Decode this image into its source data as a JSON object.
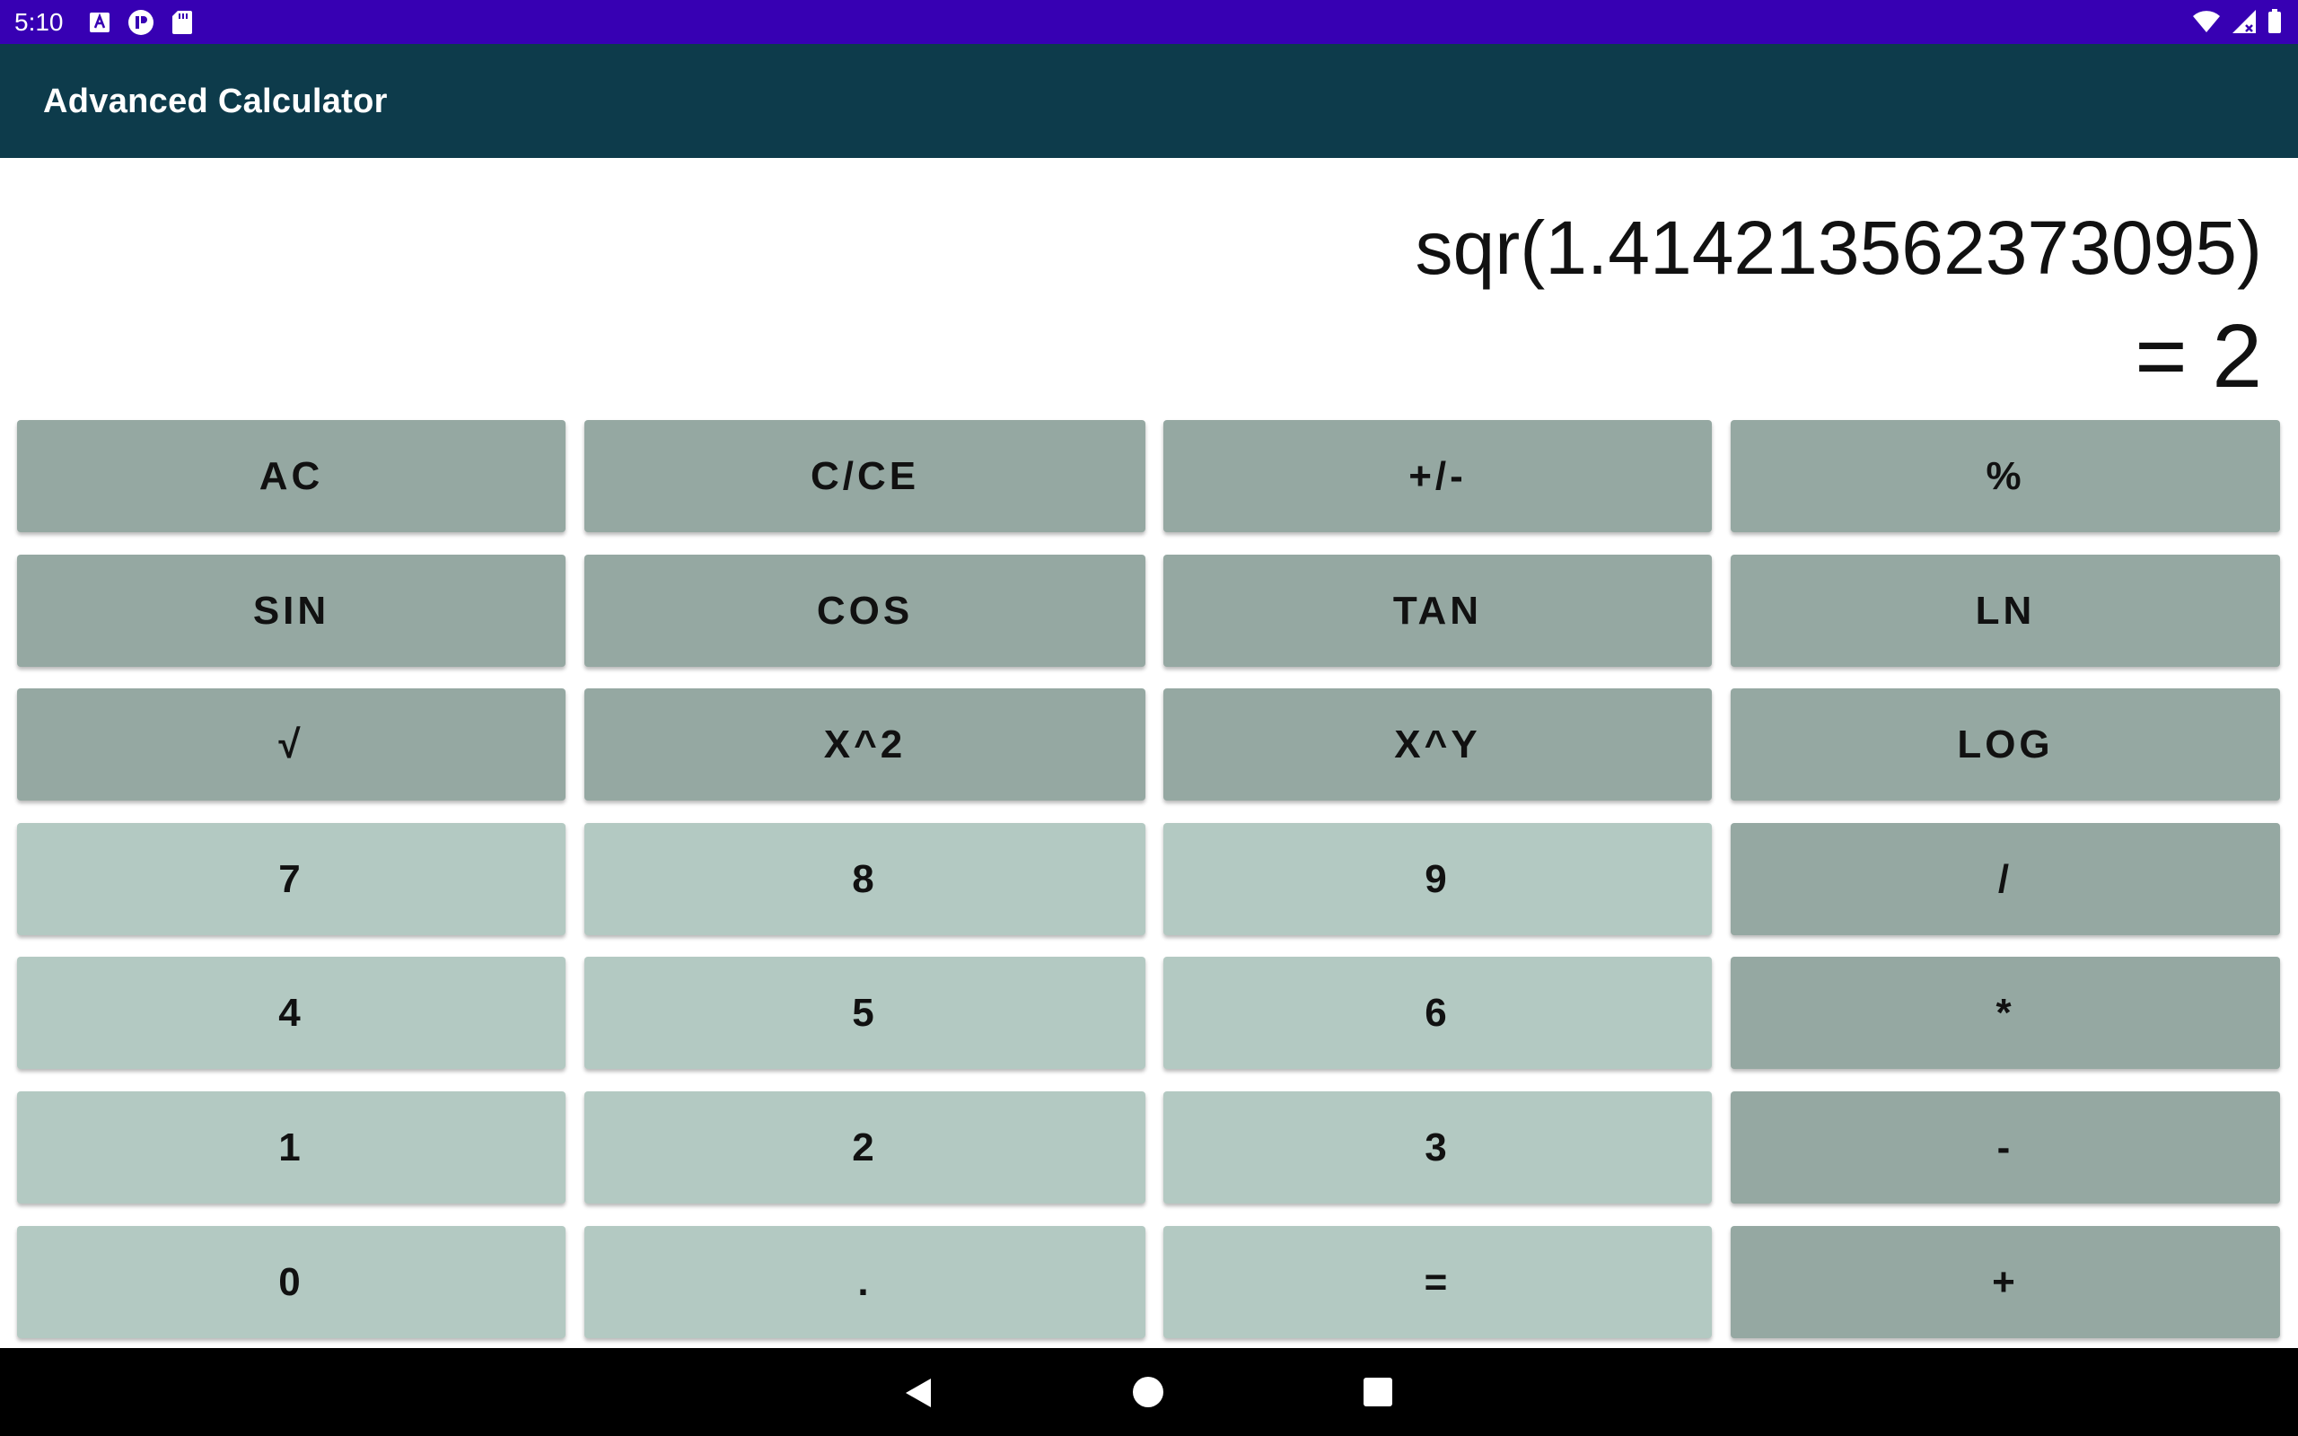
{
  "status_bar": {
    "time": "5:10",
    "left_icons": [
      "a-icon",
      "app-icon",
      "sd-card-icon"
    ],
    "right_icons": [
      "wifi-icon",
      "signal-icon",
      "battery-icon"
    ],
    "background": "#3700b3"
  },
  "app_bar": {
    "title": "Advanced Calculator",
    "background": "#0d3b4b"
  },
  "display": {
    "expression": "sqr(1.414213562373095)",
    "result": "= 2"
  },
  "keypad": {
    "colors": {
      "operator": "#95a8a2",
      "digit": "#b3c9c2"
    },
    "rows": [
      [
        "AC",
        "C/CE",
        "+/-",
        "%"
      ],
      [
        "SIN",
        "COS",
        "TAN",
        "LN"
      ],
      [
        "√",
        "X^2",
        "X^Y",
        "LOG"
      ],
      [
        "7",
        "8",
        "9",
        "/"
      ],
      [
        "4",
        "5",
        "6",
        "*"
      ],
      [
        "1",
        "2",
        "3",
        "-"
      ],
      [
        "0",
        ".",
        "=",
        "+"
      ]
    ]
  },
  "nav_bar": {
    "icons": [
      "back-icon",
      "home-icon",
      "recents-icon"
    ]
  }
}
